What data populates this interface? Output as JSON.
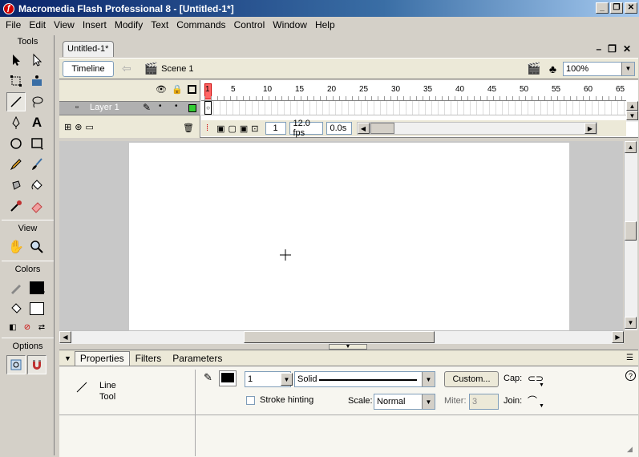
{
  "window": {
    "title": "Macromedia Flash Professional 8 - [Untitled-1*]",
    "app_icon": "flash-icon"
  },
  "menu": [
    "File",
    "Edit",
    "View",
    "Insert",
    "Modify",
    "Text",
    "Commands",
    "Control",
    "Window",
    "Help"
  ],
  "tools": {
    "header": "Tools",
    "view_header": "View",
    "colors_header": "Colors",
    "options_header": "Options"
  },
  "document": {
    "tab": "Untitled-1*"
  },
  "editbar": {
    "timeline_label": "Timeline",
    "scene_label": "Scene 1",
    "zoom": "100%"
  },
  "timeline": {
    "layer_name": "Layer 1",
    "ruler_ticks": [
      "1",
      "5",
      "10",
      "15",
      "20",
      "25",
      "30",
      "35",
      "40",
      "45",
      "50",
      "55",
      "60",
      "65"
    ],
    "current_frame": "1",
    "frame_rate": "12.0 fps",
    "elapsed": "0.0s"
  },
  "properties": {
    "tabs": [
      "Properties",
      "Filters",
      "Parameters"
    ],
    "tool_name_line1": "Line",
    "tool_name_line2": "Tool",
    "stroke_height": "1",
    "stroke_style": "Solid",
    "custom_label": "Custom...",
    "cap_label": "Cap:",
    "join_label": "Join:",
    "stroke_hinting_label": "Stroke hinting",
    "scale_label": "Scale:",
    "scale_value": "Normal",
    "miter_label": "Miter:",
    "miter_value": "3",
    "help": "?"
  },
  "colors": {
    "accent": "#0a246a",
    "playhead": "#ff6666",
    "stroke_swatch": "#000000",
    "fill_swatch": "#ffffff",
    "layer_outline": "#33cc33"
  }
}
